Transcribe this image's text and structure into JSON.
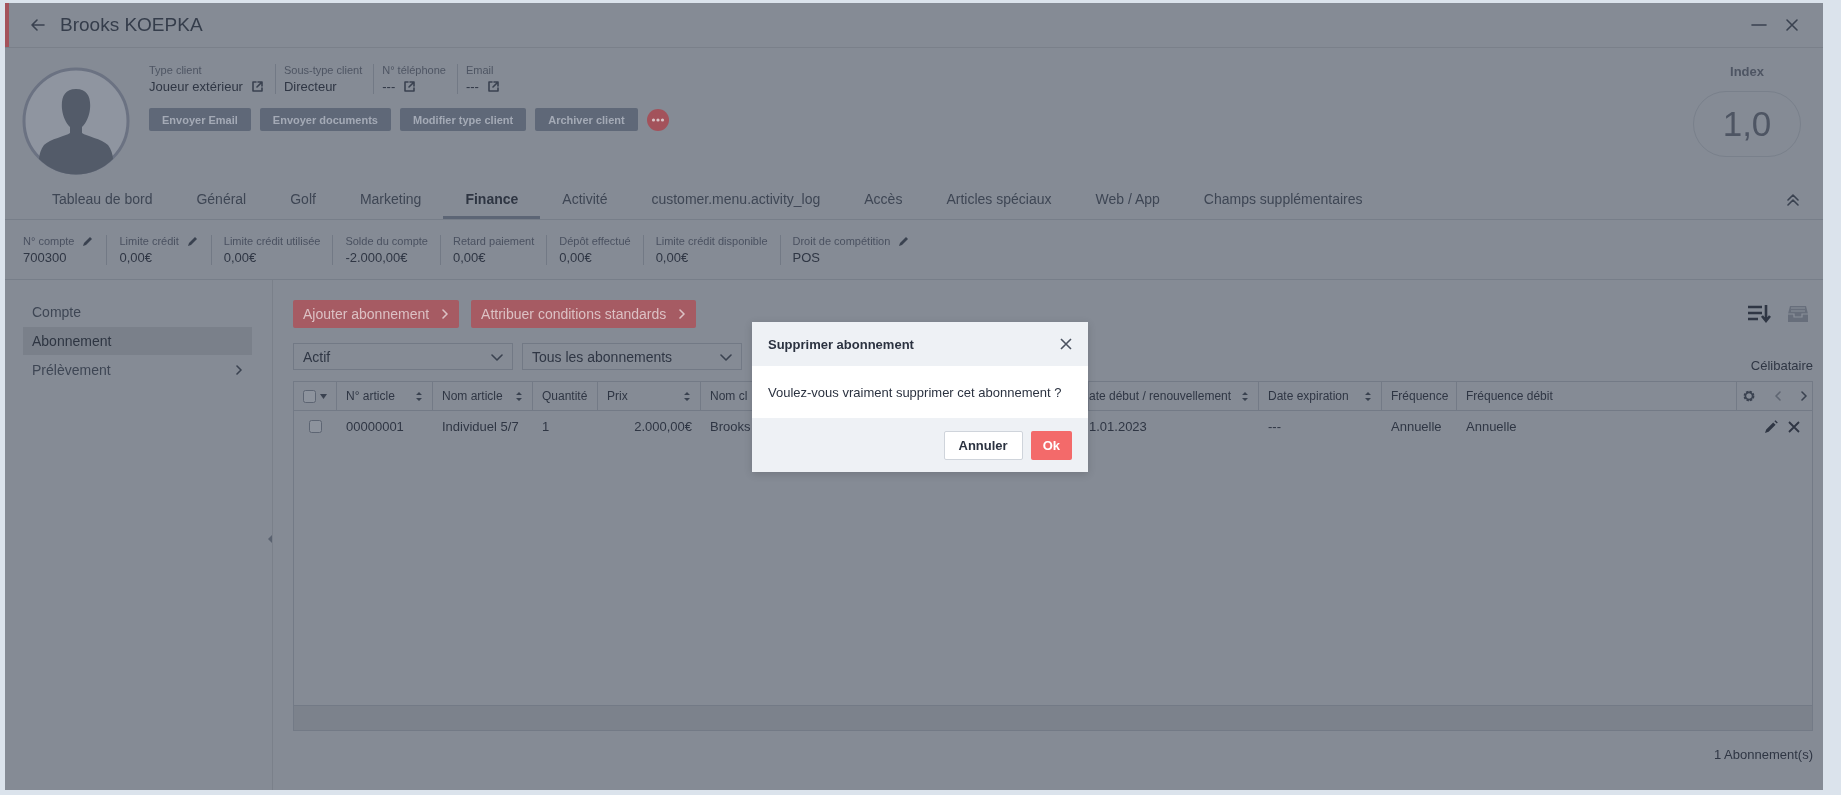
{
  "window": {
    "title": "Brooks KOEPKA"
  },
  "profile": {
    "fields": [
      {
        "label": "Type client",
        "value": "Joueur extérieur",
        "link": true
      },
      {
        "label": "Sous-type client",
        "value": "Directeur",
        "link": false
      },
      {
        "label": "N° téléphone",
        "value": "---",
        "link": true
      },
      {
        "label": "Email",
        "value": "---",
        "link": true
      }
    ],
    "actions": [
      "Envoyer Email",
      "Envoyer documents",
      "Modifier type client",
      "Archiver client"
    ],
    "index": {
      "label": "Index",
      "value": "1,0"
    }
  },
  "tabs": [
    {
      "label": "Tableau de bord",
      "selected": false
    },
    {
      "label": "Général",
      "selected": false
    },
    {
      "label": "Golf",
      "selected": false
    },
    {
      "label": "Marketing",
      "selected": false
    },
    {
      "label": "Finance",
      "selected": true
    },
    {
      "label": "Activité",
      "selected": false
    },
    {
      "label": "customer.menu.activity_log",
      "selected": false
    },
    {
      "label": "Accès",
      "selected": false
    },
    {
      "label": "Articles spéciaux",
      "selected": false
    },
    {
      "label": "Web / App",
      "selected": false
    },
    {
      "label": "Champs supplémentaires",
      "selected": false
    }
  ],
  "account_summary": [
    {
      "label": "N° compte",
      "value": "700300",
      "editable": true
    },
    {
      "label": "Limite crédit",
      "value": "0,00€",
      "editable": true
    },
    {
      "label": "Limite crédit utilisée",
      "value": "0,00€",
      "editable": false
    },
    {
      "label": "Solde du compte",
      "value": "-2.000,00€",
      "editable": false
    },
    {
      "label": "Retard paiement",
      "value": "0,00€",
      "editable": false
    },
    {
      "label": "Dépôt effectué",
      "value": "0,00€",
      "editable": false
    },
    {
      "label": "Limite crédit disponible",
      "value": "0,00€",
      "editable": false
    },
    {
      "label": "Droit de compétition",
      "value": "POS",
      "editable": true
    }
  ],
  "sidebar": {
    "items": [
      {
        "label": "Compte",
        "selected": false,
        "expandable": false
      },
      {
        "label": "Abonnement",
        "selected": true,
        "expandable": false
      },
      {
        "label": "Prélèvement",
        "selected": false,
        "expandable": true
      }
    ]
  },
  "toolbar": {
    "buttons": [
      "Ajouter abonnement",
      "Attribuer conditions standards"
    ],
    "filters": [
      {
        "value": "Actif"
      },
      {
        "value": "Tous les abonnements"
      }
    ],
    "tag": "Célibataire"
  },
  "table": {
    "all_checked": false,
    "columns": [
      {
        "label": "N° article",
        "sortable": true,
        "kind": "text"
      },
      {
        "label": "Nom article",
        "sortable": true,
        "kind": "text"
      },
      {
        "label": "Quantité",
        "sortable": false,
        "kind": "text"
      },
      {
        "label": "Prix",
        "sortable": true,
        "kind": "number"
      },
      {
        "label": "Nom cl",
        "kind": "text"
      },
      {
        "label": "ate début / renouvellement",
        "sortable": true,
        "kind": "text"
      },
      {
        "label": "Date expiration",
        "sortable": true,
        "kind": "text"
      },
      {
        "label": "Fréquence",
        "sortable": false,
        "kind": "text"
      },
      {
        "label": "Fréquence débit",
        "sortable": false,
        "kind": "text"
      }
    ],
    "rows": [
      {
        "checked": false,
        "cells": [
          "00000001",
          "Individuel 5/7",
          "1",
          "2.000,00€",
          "Brooks",
          "1.01.2023",
          "---",
          "Annuelle",
          "Annuelle"
        ]
      }
    ],
    "footer": "1 Abonnement(s)"
  },
  "dialog": {
    "title": "Supprimer abonnement",
    "message": "Voulez-vous vraiment supprimer cet abonnement ?",
    "buttons": [
      {
        "label": "Annuler",
        "kind": "secondary"
      },
      {
        "label": "Ok",
        "kind": "primary"
      }
    ]
  }
}
